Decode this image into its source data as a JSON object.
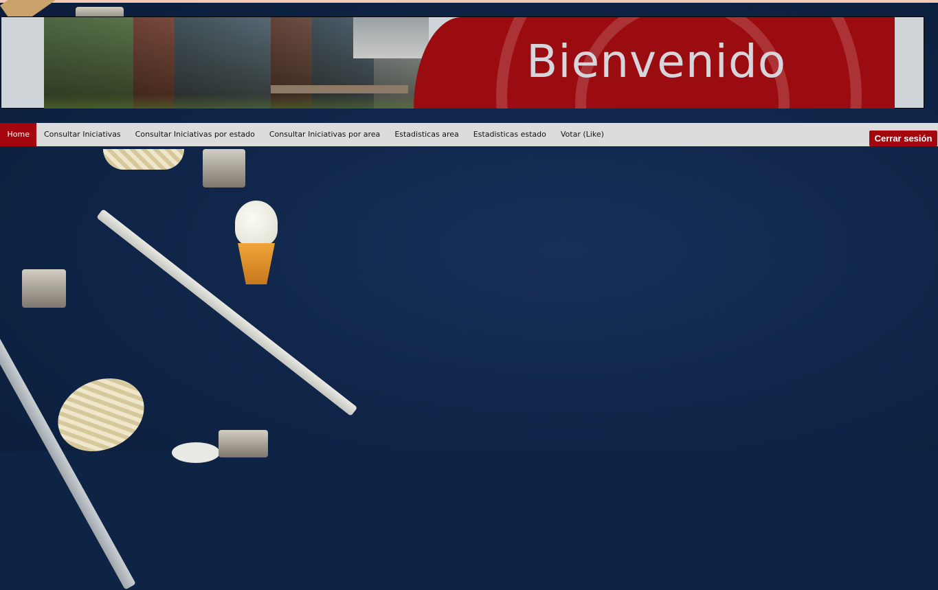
{
  "banner": {
    "title": "Bienvenido"
  },
  "nav": {
    "items": [
      {
        "label": "Home",
        "active": true
      },
      {
        "label": "Consultar Iniciativas",
        "active": false
      },
      {
        "label": "Consultar Iniciativas por estado",
        "active": false
      },
      {
        "label": "Consultar Iniciativas por area",
        "active": false
      },
      {
        "label": "Estadisticas area",
        "active": false
      },
      {
        "label": "Estadisticas estado",
        "active": false
      },
      {
        "label": "Votar (Like)",
        "active": false
      }
    ],
    "logout_label": "Cerrar sesión"
  },
  "colors": {
    "accent": "#a4060e",
    "nav_background": "#dcdcdc",
    "page_background": "#0e2444",
    "banner_red": "#9b0c10"
  }
}
